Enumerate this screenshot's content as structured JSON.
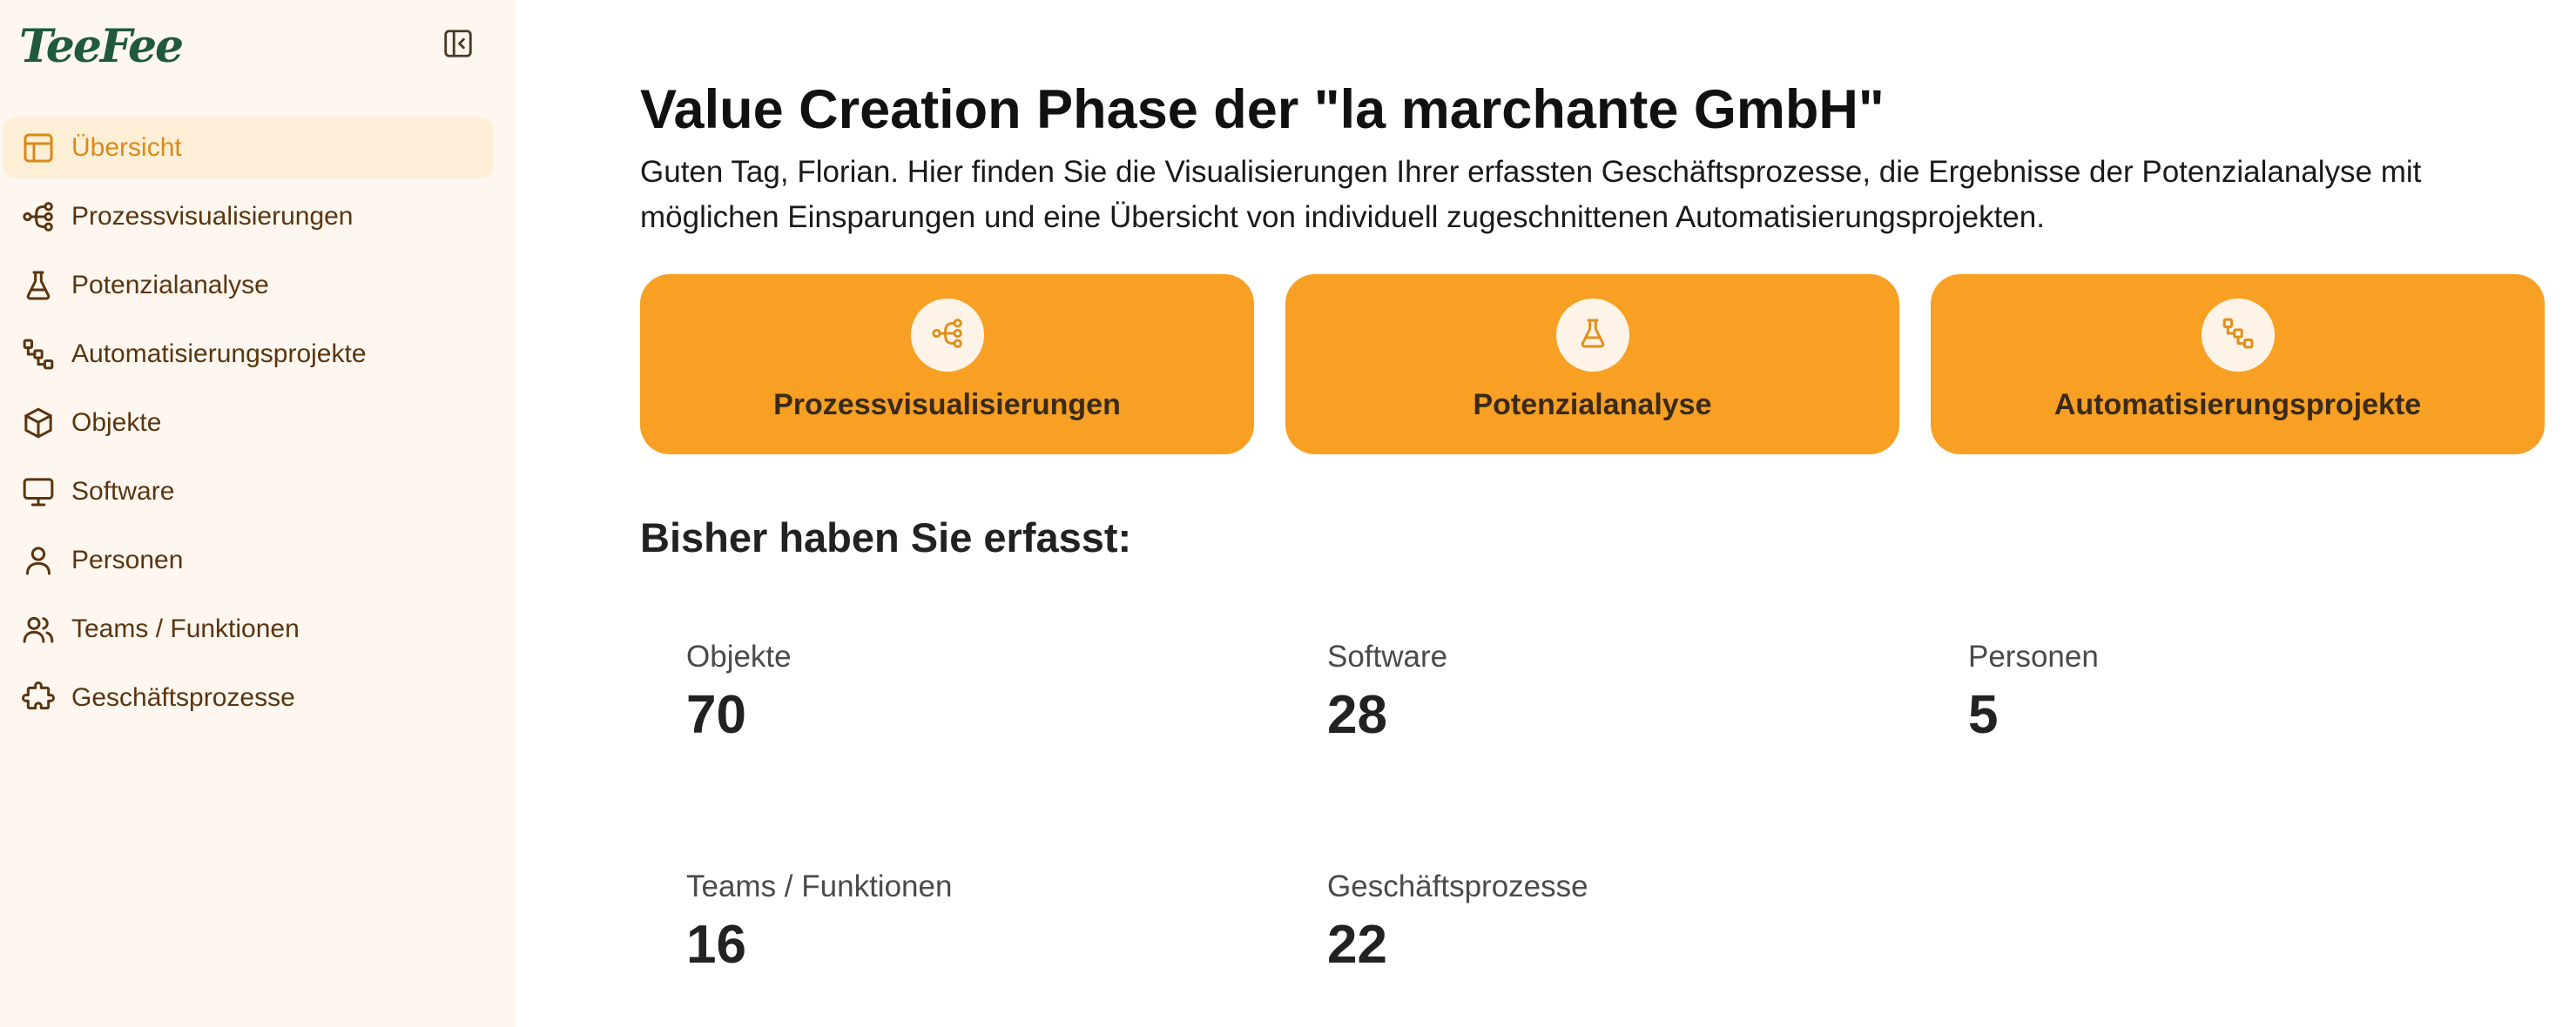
{
  "brand": {
    "logo_text": "TeeFee"
  },
  "sidebar": {
    "items": [
      {
        "label": "Übersicht",
        "icon": "layout-icon",
        "active": true
      },
      {
        "label": "Prozessvisualisierungen",
        "icon": "share-nodes-icon"
      },
      {
        "label": "Potenzialanalyse",
        "icon": "flask-icon"
      },
      {
        "label": "Automatisierungsprojekte",
        "icon": "workflow-icon"
      },
      {
        "label": "Objekte",
        "icon": "box-icon"
      },
      {
        "label": "Software",
        "icon": "monitor-icon"
      },
      {
        "label": "Personen",
        "icon": "user-icon"
      },
      {
        "label": "Teams / Funktionen",
        "icon": "users-icon"
      },
      {
        "label": "Geschäftsprozesse",
        "icon": "puzzle-icon"
      }
    ]
  },
  "main": {
    "title": "Value Creation Phase der \"la marchante GmbH\"",
    "intro": "Guten Tag, Florian. Hier finden Sie die Visualisierungen Ihrer erfassten Geschäftsprozesse, die Ergebnisse der Potenzialanalyse mit möglichen Einsparungen und eine Übersicht von individuell zugeschnittenen Automatisierungsprojekten.",
    "cards": [
      {
        "label": "Prozessvisualisierungen",
        "icon": "share-nodes-icon"
      },
      {
        "label": "Potenzialanalyse",
        "icon": "flask-icon"
      },
      {
        "label": "Automatisierungsprojekte",
        "icon": "workflow-icon"
      }
    ],
    "section_title": "Bisher haben Sie erfasst:",
    "stats": [
      {
        "label": "Objekte",
        "value": "70"
      },
      {
        "label": "Software",
        "value": "28"
      },
      {
        "label": "Personen",
        "value": "5"
      },
      {
        "label": "Teams / Funktionen",
        "value": "16"
      },
      {
        "label": "Geschäftsprozesse",
        "value": "22"
      }
    ]
  },
  "colors": {
    "sidebar_bg": "#fdf7ef",
    "active_bg": "#fdeed6",
    "accent": "#f7a024",
    "active_text": "#d98a16",
    "nav_text": "#5a3510",
    "brand_green": "#1f5a3a"
  }
}
